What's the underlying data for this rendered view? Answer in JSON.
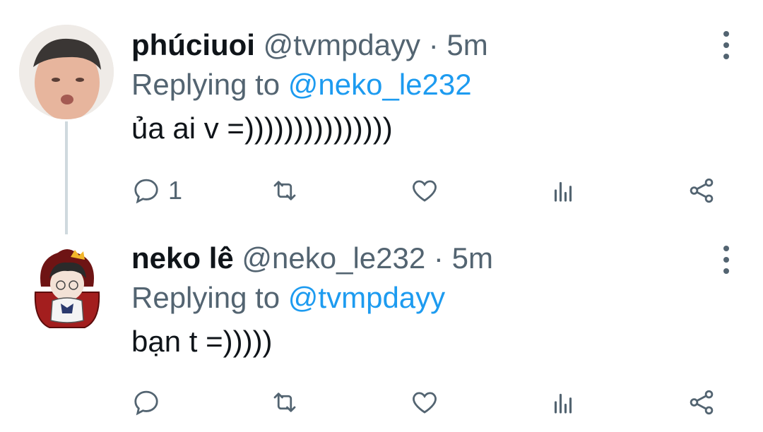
{
  "tweets": [
    {
      "display_name": "phúciuoi",
      "handle": "@tvmpdayy",
      "separator": "·",
      "time": "5m",
      "replying_prefix": "Replying to",
      "replying_to": "@neko_le232",
      "text": "ủa ai v =)))))))))))))))",
      "reply_count": "1"
    },
    {
      "display_name": "neko lê",
      "handle": "@neko_le232",
      "separator": "·",
      "time": "5m",
      "replying_prefix": "Replying to",
      "replying_to": "@tvmpdayy",
      "text": "bạn t =)))))",
      "reply_count": ""
    }
  ],
  "colors": {
    "accent": "#1d9bf0",
    "secondary_text": "#536471",
    "primary_text": "#0f1419"
  },
  "icons": [
    "reply-icon",
    "retweet-icon",
    "like-icon",
    "analytics-icon",
    "share-icon",
    "more-icon"
  ]
}
